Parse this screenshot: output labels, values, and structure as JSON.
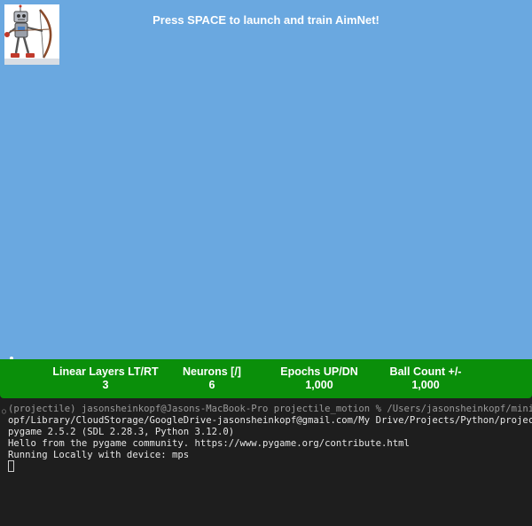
{
  "game": {
    "banner": "Press SPACE to launch and train AimNet!",
    "sky_color": "#6aa8e0",
    "robot_icon": "robot-archer-icon"
  },
  "panel": {
    "color": "#0a8f0a",
    "stats": [
      {
        "label": "Linear Layers LT/RT",
        "value": "3"
      },
      {
        "label": "Neurons [/]",
        "value": "6"
      },
      {
        "label": "Epochs UP/DN",
        "value": "1,000"
      },
      {
        "label": "Ball Count +/-",
        "value": "1,000"
      }
    ]
  },
  "terminal": {
    "lines": [
      "(projectile) jasonsheinkopf@Jasons-MacBook-Pro projectile_motion % /Users/jasonsheinkopf/miniforge",
      "opf/Library/CloudStorage/GoogleDrive-jasonsheinkopf@gmail.com/My Drive/Projects/Python/projectile_",
      "pygame 2.5.2 (SDL 2.28.3, Python 3.12.0)",
      "Hello from the pygame community. https://www.pygame.org/contribute.html",
      "Running Locally with device: mps"
    ]
  }
}
